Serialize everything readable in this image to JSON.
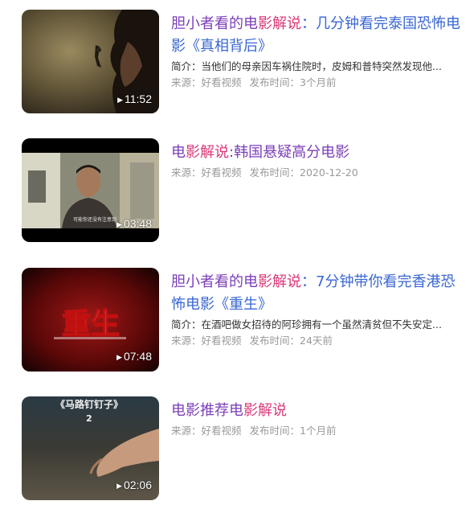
{
  "results": [
    {
      "title_a": "胆小者看的电",
      "title_b": "影解说",
      "title_c": "：几分钟看完泰国恐怖电影《真相背后》",
      "description": "简介：当他们的母亲因车祸住院时，皮姆和普特突然发现他...",
      "source": "来源：好看视频",
      "publish": "发布时间：3个月前",
      "duration": "11:52",
      "thumb_icon": "dark-wall-woman-thumbnail"
    },
    {
      "title_a": "电",
      "title_b": "影解说",
      "title_c": ":韩国悬疑高分电影",
      "description": "",
      "source": "来源：好看视频",
      "publish": "发布时间：2020-12-20",
      "duration": "03:48",
      "thumb_caption": "可能你还没有注意到",
      "thumb_icon": "man-in-room-thumbnail"
    },
    {
      "title_a": "胆小者看的电",
      "title_b": "影解说",
      "title_c": "：7分钟带你看完香港恐怖电影《重生》",
      "description": "简介：在酒吧做女招待的阿珍拥有一个虽然清贫但不失安定...",
      "source": "来源：好看视频",
      "publish": "发布时间：24天前",
      "duration": "07:48",
      "thumb_caption": "重生",
      "thumb_icon": "red-movie-poster-thumbnail"
    },
    {
      "title_a": "电影推荐电",
      "title_b": "影解说",
      "title_c": "",
      "description": "",
      "source": "来源：好看视频",
      "publish": "发布时间：1个月前",
      "duration": "02:06",
      "thumb_caption": "《马路钉钉子》",
      "thumb_caption2": "2",
      "thumb_icon": "hand-on-ground-thumbnail"
    }
  ],
  "colors": {
    "title_purple": "#7b3fb8",
    "title_pink": "#d93a7a",
    "title_blue": "#3a67d1",
    "meta_gray": "#999999"
  }
}
